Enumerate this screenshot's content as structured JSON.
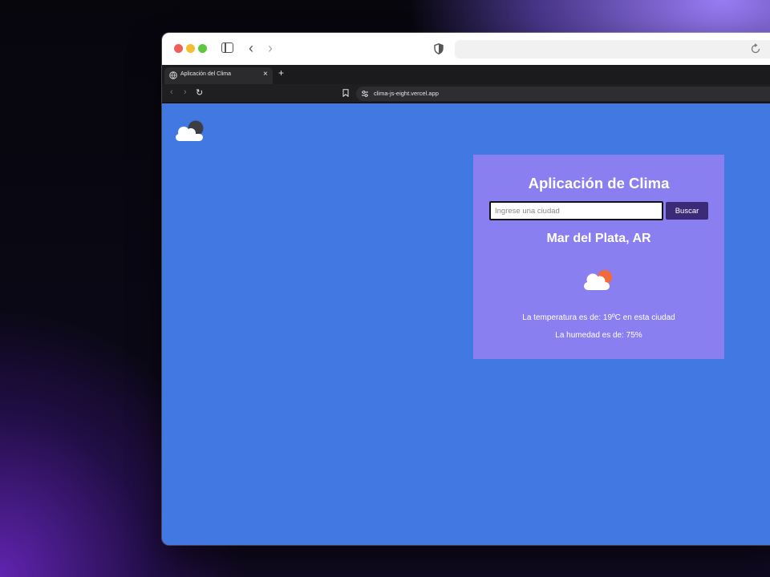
{
  "browser": {
    "tab_title": "Aplicación del Clima",
    "tab_close": "×",
    "new_tab": "+",
    "url": "clima-js-eight.vercel.app"
  },
  "app": {
    "logo_icon": "cloud-moon-icon",
    "title": "Aplicación de Clima",
    "search": {
      "placeholder": "Ingrese una ciudad",
      "value": "",
      "button_label": "Buscar"
    },
    "city": "Mar del Plata, AR",
    "weather_icon": "cloud-sun-icon",
    "temperature_text": "La temperatura es de: 19ºC en esta ciudad",
    "humidity_text": "La humedad es de: 75%"
  },
  "colors": {
    "page_background": "#4178e1",
    "card_background": "#8a7ff0",
    "button_background": "#3b2a78"
  }
}
